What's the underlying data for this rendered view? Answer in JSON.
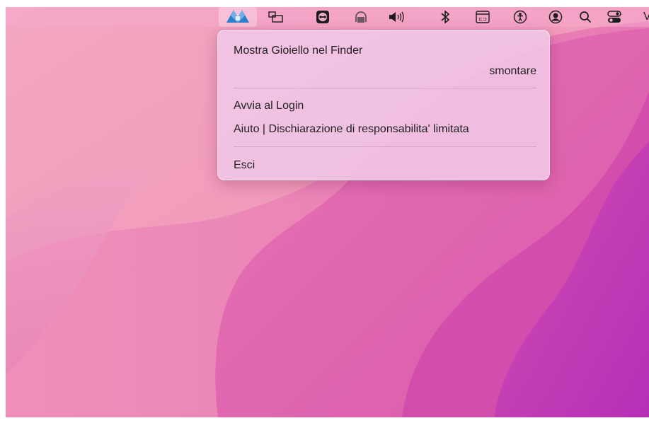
{
  "colors": {
    "wallpaper_light": "#f29bbb",
    "wallpaper_mid": "#dc5aa9",
    "wallpaper_deep": "#b42bb5",
    "menubar": "#f7b2d2",
    "menu_background": "#f1c4e4",
    "app_icon_blue": "#2d7fd0"
  },
  "menubar": {
    "status_icons": [
      "app-logo-icon",
      "window-switcher-icon",
      "teamviewer-icon",
      "headphones-icon",
      "volume-icon",
      "bluetooth-icon",
      "keyboard-input-icon",
      "accessibility-icon",
      "user-account-icon",
      "search-icon",
      "control-center-icon"
    ],
    "overflow_label": "V"
  },
  "menu": {
    "items": [
      {
        "label": "Mostra Gioiello nel Finder"
      },
      {
        "label": "smontare"
      },
      {
        "label": "Avvia al Login"
      },
      {
        "label": "Aiuto | Dischiarazione di responsabilita' limitata"
      },
      {
        "label": "Esci"
      }
    ]
  }
}
